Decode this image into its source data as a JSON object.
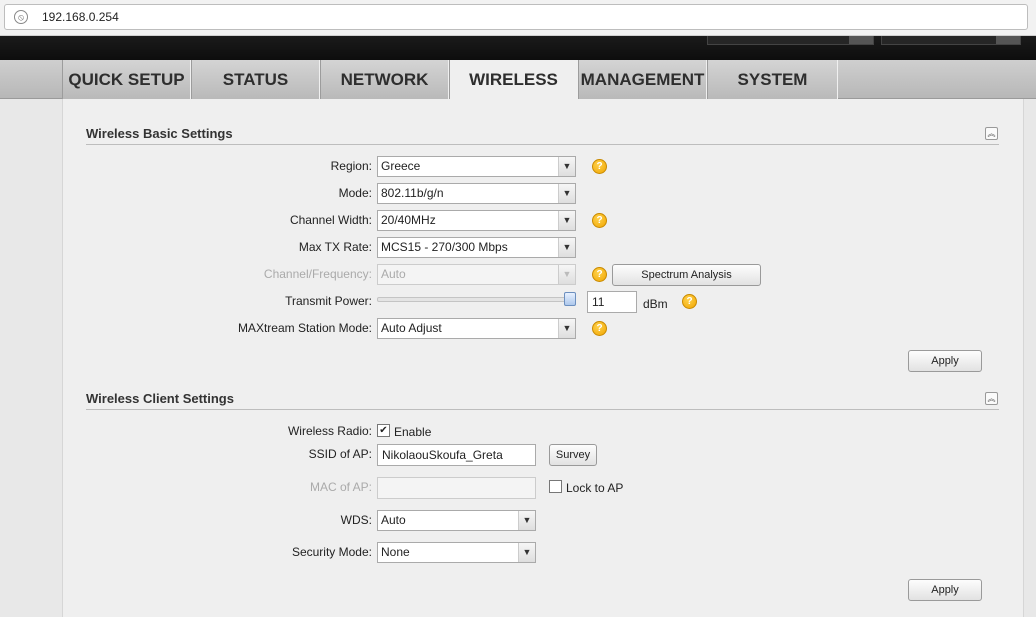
{
  "browser": {
    "url": "192.168.0.254"
  },
  "tabs": [
    {
      "label": "QUICK SETUP"
    },
    {
      "label": "STATUS"
    },
    {
      "label": "NETWORK"
    },
    {
      "label": "WIRELESS"
    },
    {
      "label": "MANAGEMENT"
    },
    {
      "label": "SYSTEM"
    }
  ],
  "active_tab": "WIRELESS",
  "basic": {
    "title": "Wireless Basic Settings",
    "region_label": "Region:",
    "region_value": "Greece",
    "mode_label": "Mode:",
    "mode_value": "802.11b/g/n",
    "channel_width_label": "Channel Width:",
    "channel_width_value": "20/40MHz",
    "max_tx_label": "Max TX Rate:",
    "max_tx_value": "MCS15 - 270/300 Mbps",
    "channel_freq_label": "Channel/Frequency:",
    "channel_freq_value": "Auto",
    "spectrum_button": "Spectrum Analysis",
    "tx_power_label": "Transmit Power:",
    "tx_power_value": "11",
    "tx_power_unit": "dBm",
    "tx_power_slider_fraction": 1.0,
    "maxtream_label": "MAXtream Station Mode:",
    "maxtream_value": "Auto Adjust",
    "apply_button": "Apply"
  },
  "client": {
    "title": "Wireless Client Settings",
    "radio_label": "Wireless Radio:",
    "radio_checked": true,
    "radio_enable_text": "Enable",
    "ssid_label": "SSID of AP:",
    "ssid_value": "NikolaouSkoufa_Greta",
    "survey_button": "Survey",
    "mac_label": "MAC of AP:",
    "mac_value": "",
    "lock_label": "Lock to AP",
    "lock_checked": false,
    "wds_label": "WDS:",
    "wds_value": "Auto",
    "security_label": "Security Mode:",
    "security_value": "None",
    "apply_button": "Apply"
  },
  "icons": {
    "help": "help-icon",
    "collapse": "collapse-icon",
    "dropdown": "chevron-down-icon",
    "site": "site-info-icon"
  },
  "colors": {
    "help": "#f0a500",
    "banner": "#111111"
  }
}
